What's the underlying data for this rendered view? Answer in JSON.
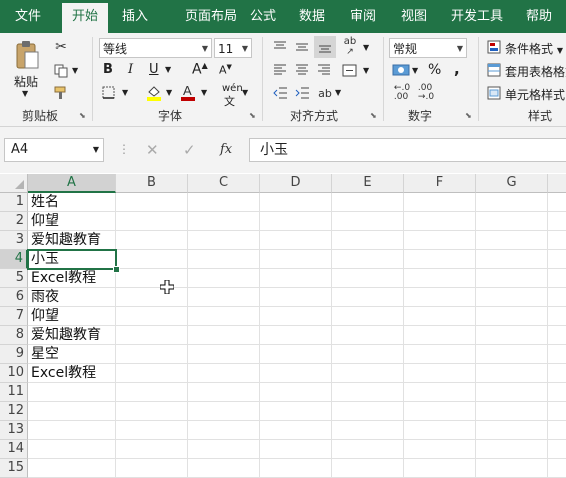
{
  "tabs": [
    "文件",
    "开始",
    "插入",
    "页面布局",
    "公式",
    "数据",
    "审阅",
    "视图",
    "开发工具",
    "帮助"
  ],
  "ribbon": {
    "clipboard": {
      "paste": "粘贴",
      "label": "剪贴板"
    },
    "font": {
      "name": "等线",
      "size": "11",
      "label": "字体",
      "bold": "B",
      "italic": "I",
      "underline": "U",
      "grow": "A",
      "shrink": "A",
      "phonetic": "wén"
    },
    "alignment": {
      "label": "对齐方式"
    },
    "number": {
      "format": "常规",
      "label": "数字",
      "percent": "%",
      "comma": ","
    },
    "styles": {
      "conditional": "条件格式",
      "table": "套用表格格式",
      "cell": "单元格样式",
      "label": "样式"
    }
  },
  "formula_bar": {
    "name_box": "A4",
    "fx": "fx",
    "content": "小玉"
  },
  "sheet": {
    "columns": [
      "A",
      "B",
      "C",
      "D",
      "E",
      "F",
      "G"
    ],
    "rows": [
      "1",
      "2",
      "3",
      "4",
      "5",
      "6",
      "7",
      "8",
      "9",
      "10",
      "11",
      "12",
      "13",
      "14",
      "15"
    ],
    "col_a": [
      "姓名",
      "仰望",
      "爱知趣教育",
      "小玉",
      "Excel教程",
      "雨夜",
      "仰望",
      "爱知趣教育",
      "星空",
      "Excel教程",
      "",
      "",
      "",
      "",
      ""
    ],
    "active_cell": "A4"
  },
  "colors": {
    "brand": "#217346",
    "ribbon_bg": "#f3f3f3",
    "highlight": "#ffff00",
    "font_color": "#c00000"
  }
}
